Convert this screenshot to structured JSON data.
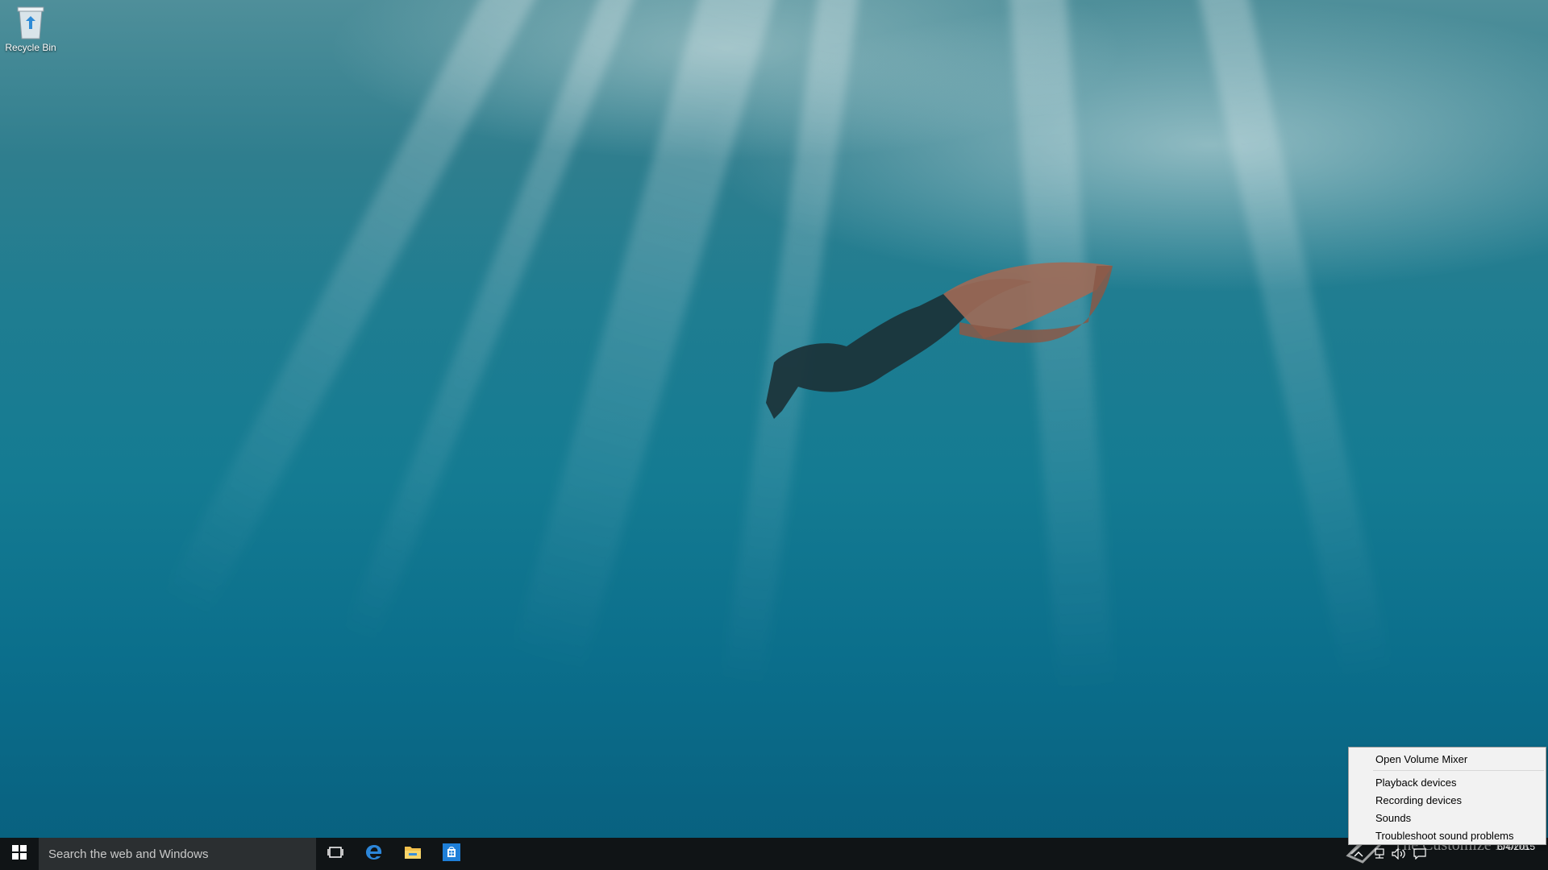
{
  "desktop": {
    "icons": [
      {
        "label": "Recycle Bin",
        "icon": "recycle-bin-icon"
      }
    ]
  },
  "taskbar": {
    "start_icon": "windows-logo-icon",
    "search_placeholder": "Search the web and Windows",
    "pinned": [
      {
        "name": "task-view",
        "icon": "task-view-icon"
      },
      {
        "name": "edge",
        "icon": "edge-icon"
      },
      {
        "name": "file-explorer",
        "icon": "folder-icon"
      },
      {
        "name": "store",
        "icon": "store-icon"
      }
    ],
    "tray_icons": [
      "chevron-up-icon",
      "network-icon",
      "volume-icon",
      "action-center-icon"
    ],
    "clock": {
      "time": "",
      "date": "6/4/2015"
    }
  },
  "context_menu": {
    "items": [
      "Open Volume Mixer",
      "Playback devices",
      "Recording devices",
      "Sounds",
      "Troubleshoot sound problems"
    ]
  },
  "watermark": {
    "text": "The Customize Book"
  },
  "colors": {
    "taskbar_bg": "#101416",
    "search_bg": "#2b2f31",
    "accent_blue": "#1e7fd8",
    "menu_bg": "#f2f2f2"
  }
}
